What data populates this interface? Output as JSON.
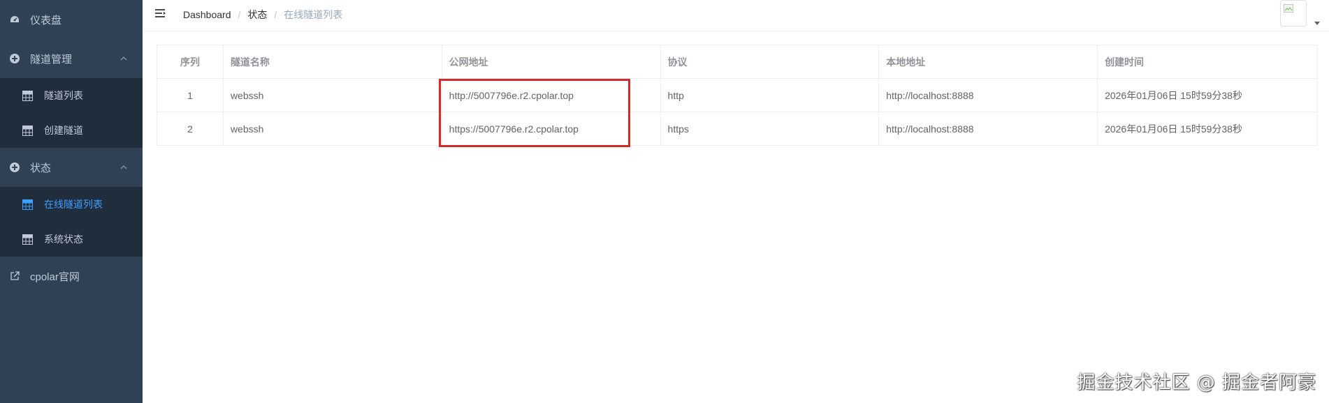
{
  "sidebar": {
    "items": [
      {
        "label": "仪表盘",
        "icon": "dashboard-icon"
      },
      {
        "label": "隧道管理",
        "icon": "plus-circle-icon",
        "expanded": true,
        "children": [
          {
            "label": "隧道列表",
            "icon": "table-icon"
          },
          {
            "label": "创建隧道",
            "icon": "table-icon"
          }
        ]
      },
      {
        "label": "状态",
        "icon": "plus-circle-icon",
        "expanded": true,
        "children": [
          {
            "label": "在线隧道列表",
            "icon": "table-icon",
            "active": true
          },
          {
            "label": "系统状态",
            "icon": "table-icon"
          }
        ]
      },
      {
        "label": "cpolar官网",
        "icon": "external-link-icon"
      }
    ]
  },
  "breadcrumb": [
    "Dashboard",
    "状态",
    "在线隧道列表"
  ],
  "table": {
    "columns": [
      "序列",
      "隧道名称",
      "公网地址",
      "协议",
      "本地地址",
      "创建时间"
    ],
    "rows": [
      [
        "1",
        "webssh",
        "http://5007796e.r2.cpolar.top",
        "http",
        "http://localhost:8888",
        "2026年01月06日 15时59分38秒"
      ],
      [
        "2",
        "webssh",
        "https://5007796e.r2.cpolar.top",
        "https",
        "http://localhost:8888",
        "2026年01月06日 15时59分38秒"
      ]
    ]
  },
  "watermark": "掘金技术社区 @ 掘金者阿豪",
  "colors": {
    "sidebar_bg": "#304156",
    "submenu_bg": "#1f2d3d",
    "active": "#409eff",
    "highlight": "#d42a2a"
  }
}
